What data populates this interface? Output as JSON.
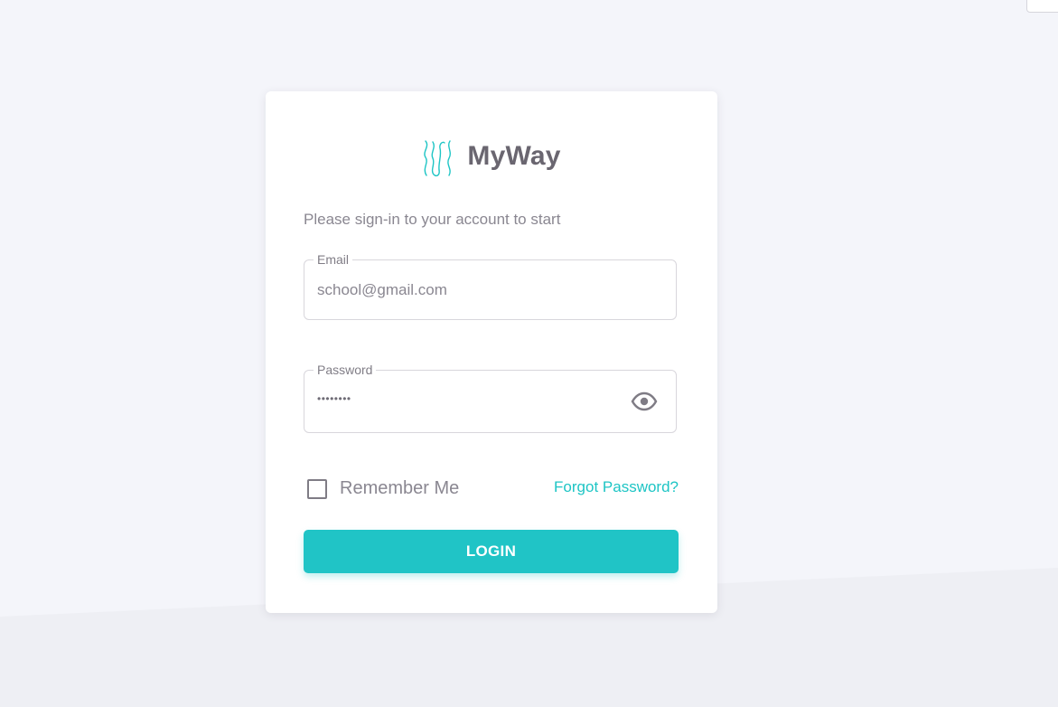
{
  "brand": {
    "name": "MyWay",
    "logo_icon": "myway-wave-logo-icon",
    "accent_color": "#1ec5c5"
  },
  "login": {
    "subtitle": "Please sign-in to your account to start",
    "email": {
      "label": "Email",
      "value": "school@gmail.com"
    },
    "password": {
      "label": "Password",
      "masked_value": "••••••••",
      "toggle_icon": "eye-icon"
    },
    "remember_me": {
      "label": "Remember Me",
      "checked": false
    },
    "forgot_password_label": "Forgot Password?",
    "submit_label": "LOGIN"
  }
}
